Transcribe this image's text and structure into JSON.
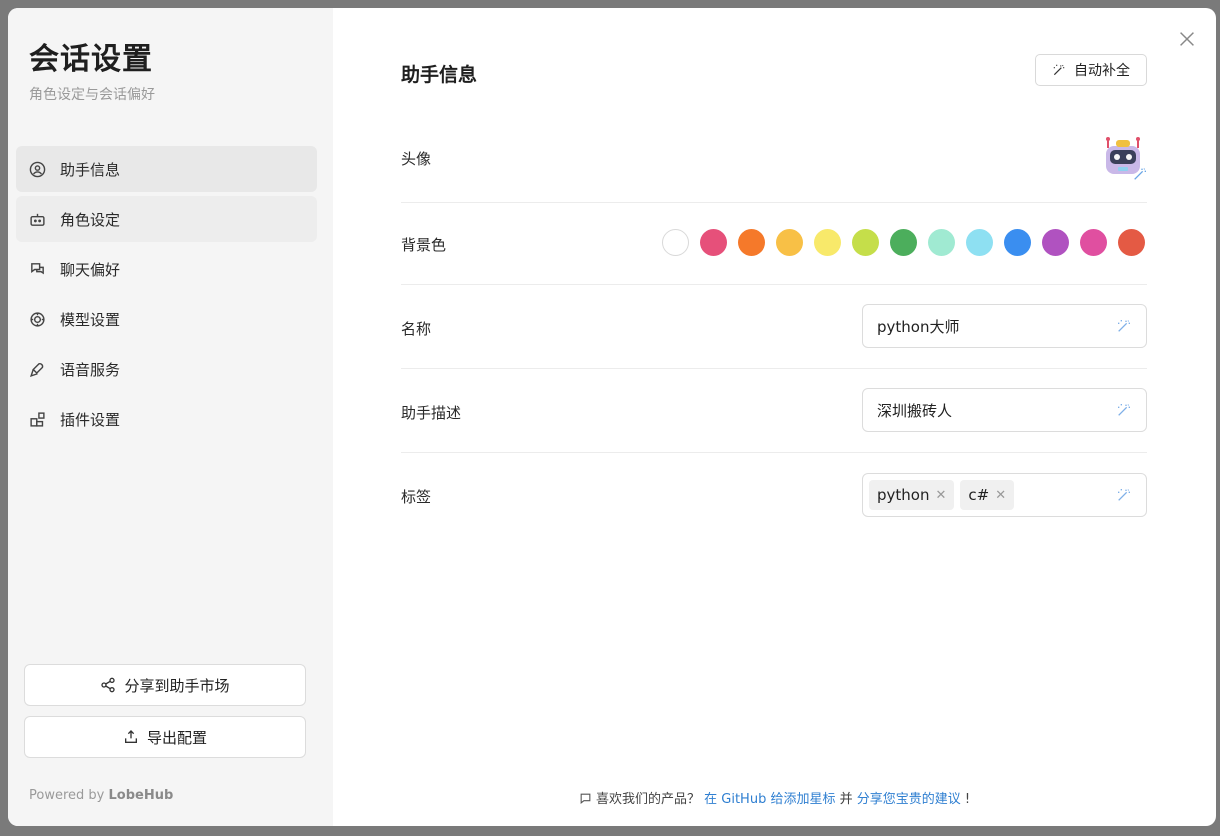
{
  "sidebar": {
    "title": "会话设置",
    "subtitle": "角色设定与会话偏好",
    "items": [
      {
        "label": "助手信息",
        "icon": "user-circle-icon"
      },
      {
        "label": "角色设定",
        "icon": "bot-icon"
      },
      {
        "label": "聊天偏好",
        "icon": "chat-icon"
      },
      {
        "label": "模型设置",
        "icon": "brain-icon"
      },
      {
        "label": "语音服务",
        "icon": "mic-icon"
      },
      {
        "label": "插件设置",
        "icon": "blocks-icon"
      }
    ],
    "share_button": "分享到助手市场",
    "export_button": "导出配置",
    "powered_prefix": "Powered by",
    "powered_brand": "LobeHub"
  },
  "main": {
    "section_title": "助手信息",
    "auto_fill_button": "自动补全",
    "avatar_label": "头像",
    "bg_color_label": "背景色",
    "swatches": [
      "#ffffff",
      "#e6507a",
      "#f5792a",
      "#f8c046",
      "#f8e96a",
      "#c5de4a",
      "#4cae5c",
      "#a0ead2",
      "#8ee0f2",
      "#3a8ef0",
      "#b052c0",
      "#e04fa0",
      "#e45a44"
    ],
    "name_label": "名称",
    "name_value": "python大师",
    "desc_label": "助手描述",
    "desc_value": "深圳搬砖人",
    "tags_label": "标签",
    "tags": [
      "python",
      "c#"
    ]
  },
  "footer": {
    "prefix": "喜欢我们的产品？",
    "link1": "在 GitHub 给添加星标",
    "middle": "并",
    "link2": "分享您宝贵的建议",
    "suffix": "!"
  }
}
